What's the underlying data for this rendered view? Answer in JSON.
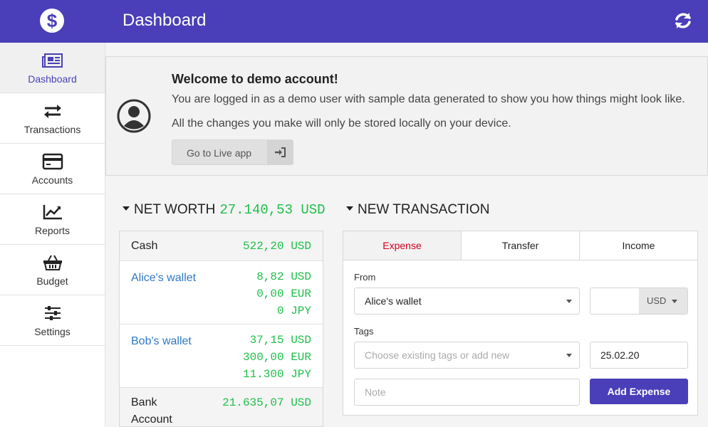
{
  "header": {
    "title": "Dashboard",
    "logo_symbol": "$"
  },
  "sidebar": {
    "items": [
      {
        "label": "Dashboard",
        "icon": "newspaper-icon",
        "active": true
      },
      {
        "label": "Transactions",
        "icon": "exchange-icon"
      },
      {
        "label": "Accounts",
        "icon": "credit-card-icon"
      },
      {
        "label": "Reports",
        "icon": "line-chart-icon"
      },
      {
        "label": "Budget",
        "icon": "basket-icon"
      },
      {
        "label": "Settings",
        "icon": "sliders-icon"
      }
    ]
  },
  "banner": {
    "title": "Welcome to demo account!",
    "line1": "You are logged in as a demo user with sample data generated to show you how things might look like.",
    "line2": "All the changes you make will only be stored locally on your device.",
    "button_label": "Go to Live app"
  },
  "net_worth": {
    "title": "NET WORTH",
    "value": "27.140,53 USD",
    "groups": [
      {
        "name": "Cash",
        "amounts": [
          "522,20 USD"
        ]
      },
      {
        "name": "Alice's wallet",
        "amounts": [
          "8,82 USD",
          "0,00 EUR",
          "0 JPY"
        ]
      },
      {
        "name": "Bob's wallet",
        "amounts": [
          "37,15 USD",
          "300,00 EUR",
          "11.300 JPY"
        ]
      },
      {
        "name": "Bank Account",
        "amounts": [
          "21.635,07 USD"
        ]
      }
    ]
  },
  "new_transaction": {
    "title": "NEW TRANSACTION",
    "tabs": [
      "Expense",
      "Transfer",
      "Income"
    ],
    "from_label": "From",
    "from_value": "Alice's wallet",
    "amount_value": "",
    "currency": "USD",
    "tags_label": "Tags",
    "tags_placeholder": "Choose existing tags or add new",
    "date_value": "25.02.20",
    "note_placeholder": "Note",
    "submit_label": "Add Expense"
  },
  "colors": {
    "brand": "#4a3fb8",
    "positive": "#1fbf4a",
    "link": "#2f78c4",
    "expense_tab": "#d0021b"
  }
}
